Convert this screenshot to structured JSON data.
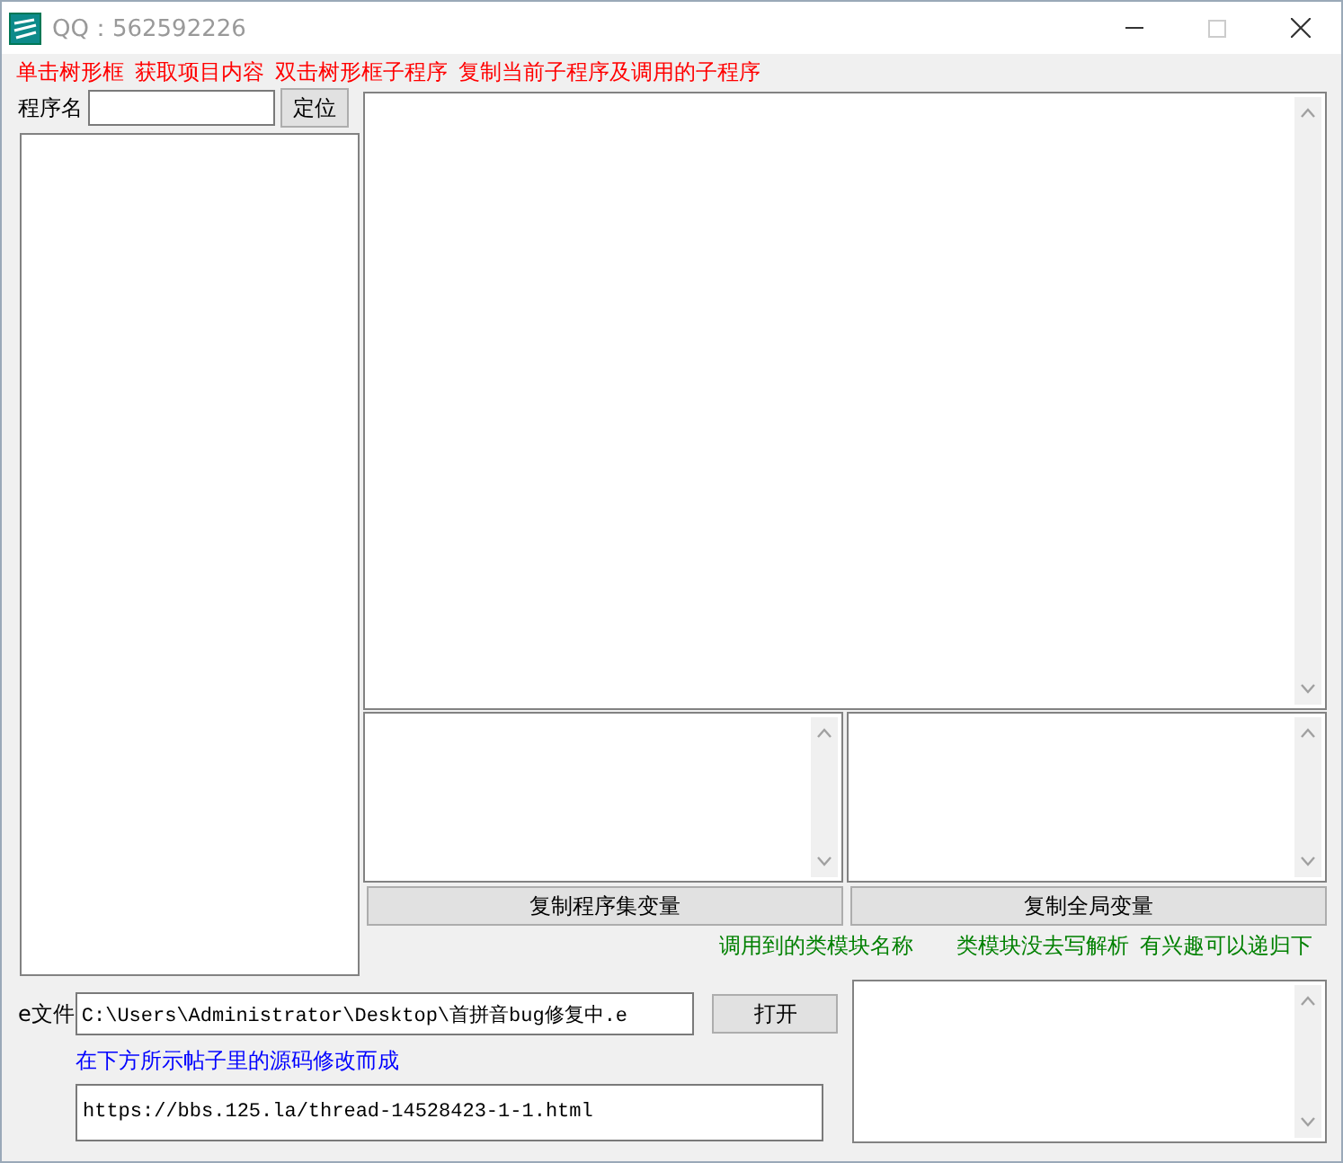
{
  "window": {
    "title": "QQ：562592226"
  },
  "hints": [
    "单击树形框",
    "获取项目内容",
    "双击树形框子程序",
    "复制当前子程序及调用的子程序"
  ],
  "search": {
    "label": "程序名",
    "button": "定位"
  },
  "buttons": [
    "复制程序集变量",
    "复制全局变量"
  ],
  "notes": [
    "调用到的类模块名称",
    "类模块没去写解析",
    "有兴趣可以递归下"
  ],
  "file": {
    "label": "e文件",
    "value": "C:\\Users\\Administrator\\Desktop\\首拼音bug修复中.e",
    "button": "打开"
  },
  "source_note": "在下方所示帖子里的源码修改而成",
  "url": "https://bbs.125.la/thread-14528423-1-1.html"
}
